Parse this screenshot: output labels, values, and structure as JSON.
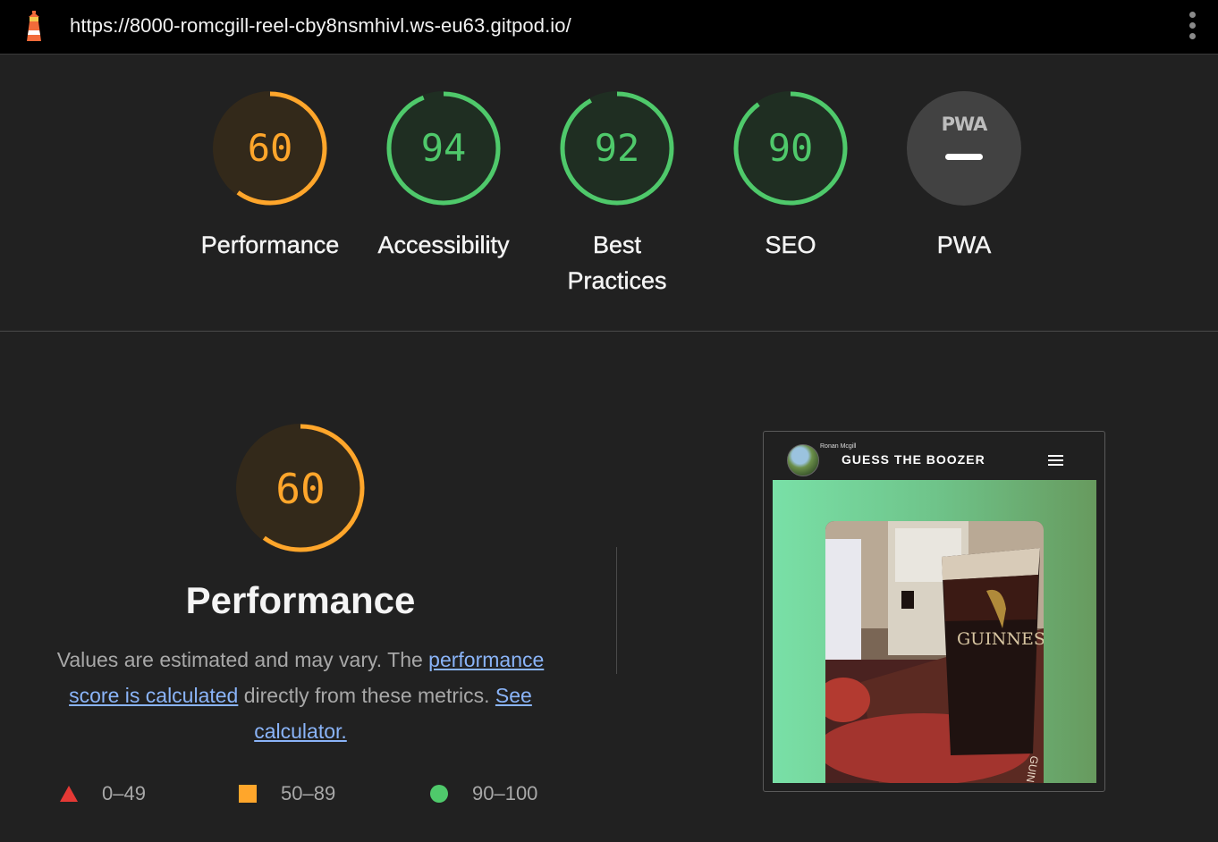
{
  "browser": {
    "url": "https://8000-romcgill-reel-cby8nsmhivl.ws-eu63.gitpod.io/"
  },
  "categories": [
    {
      "id": "performance",
      "score": 60,
      "label": "Performance",
      "rating": "average"
    },
    {
      "id": "accessibility",
      "score": 94,
      "label": "Accessibility",
      "rating": "pass"
    },
    {
      "id": "best-practices",
      "score": 92,
      "label_line1": "Best",
      "label_line2": "Practices",
      "rating": "pass"
    },
    {
      "id": "seo",
      "score": 90,
      "label": "SEO",
      "rating": "pass"
    },
    {
      "id": "pwa",
      "badge": "PWA",
      "label": "PWA",
      "rating": "na"
    }
  ],
  "performance_section": {
    "score": 60,
    "title": "Performance",
    "desc_part1": "Values are estimated and may vary. The ",
    "link_score": "performance score is calculated",
    "desc_part2": " directly from these metrics. ",
    "link_calc": "See calculator."
  },
  "legend": [
    {
      "range": "0–49",
      "shape": "triangle",
      "color": "#e53935"
    },
    {
      "range": "50–89",
      "shape": "square",
      "color": "#ffa62b"
    },
    {
      "range": "90–100",
      "shape": "circle",
      "color": "#4fc96b"
    }
  ],
  "screenshot": {
    "author": "Ronan Mcgill",
    "app_title": "GUESS THE BOOZER",
    "brand_text": "GUINNESS",
    "coaster_text": "GUIN"
  },
  "colors": {
    "average": "#ffa62b",
    "pass": "#4fc96b",
    "fail": "#e53935",
    "average_bg": "#33291a",
    "pass_bg": "#1f2e22"
  },
  "icons": {
    "logo": "lighthouse-icon",
    "menu": "kebab-menu-icon",
    "hamburger": "hamburger-icon",
    "pwa_na": "dash-icon"
  }
}
